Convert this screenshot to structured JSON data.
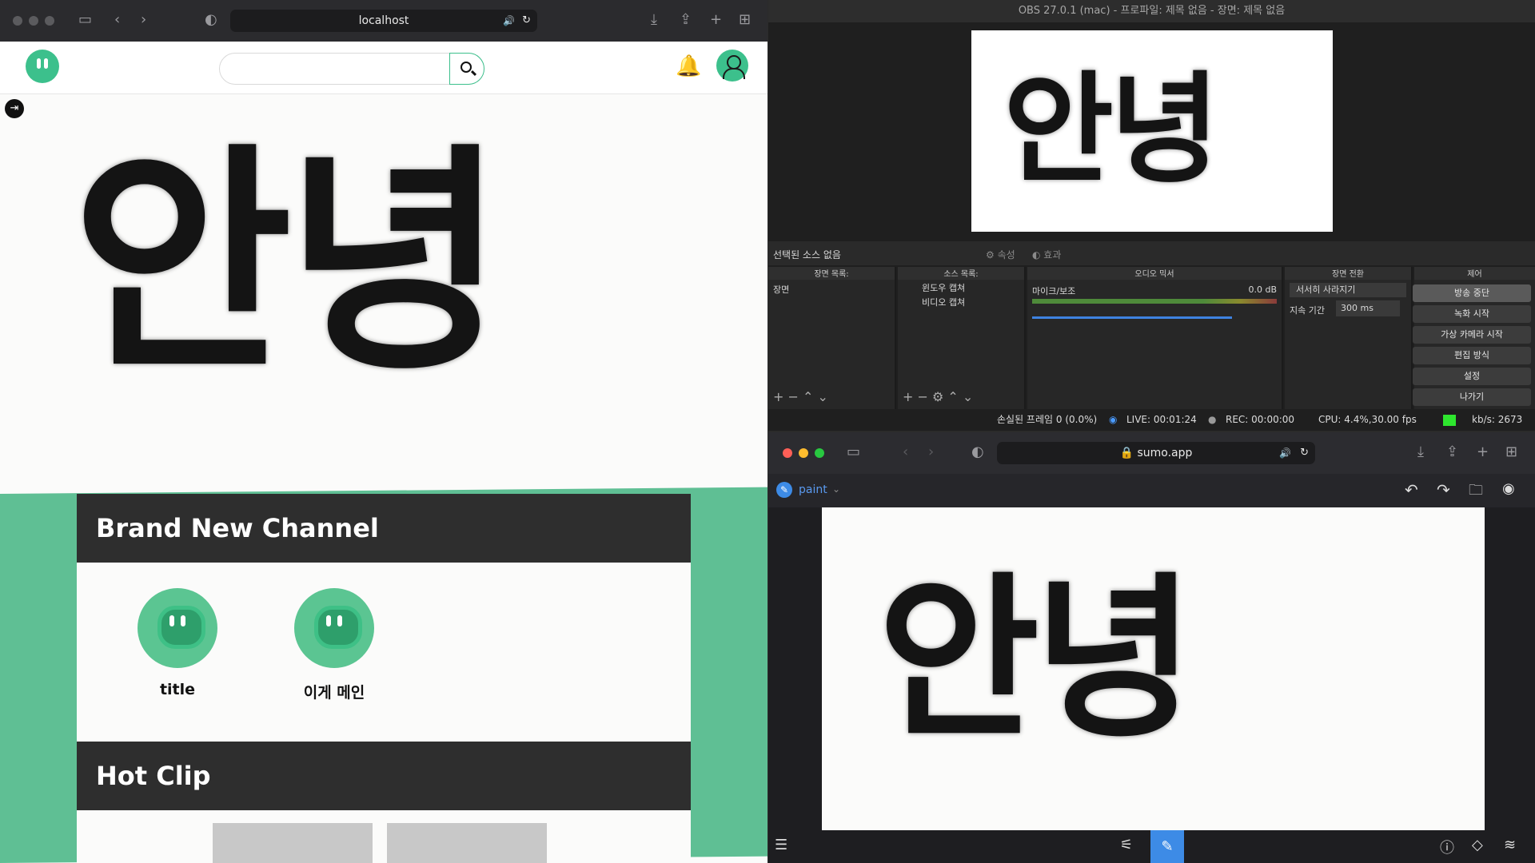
{
  "left_browser": {
    "url": "localhost",
    "drawn_text": "안녕",
    "sections": {
      "brand_new_channel": "Brand New Channel",
      "hot_clip": "Hot Clip"
    },
    "channels": [
      {
        "name": "title"
      },
      {
        "name": "이게 메인"
      }
    ]
  },
  "obs": {
    "title": "OBS 27.0.1 (mac) - 프로파일: 제목 없음 - 장면: 제목 없음",
    "preview_text": "안녕",
    "no_source": "선택된 소스 없음",
    "props": "속성",
    "filters": "효과",
    "docks": {
      "scenes": "장면 목록:",
      "sources": "소스 목록:",
      "mixer": "오디오 믹서",
      "transitions": "장면 전환",
      "controls": "제어"
    },
    "scene_item": "장면",
    "sources": [
      "윈도우 캡쳐",
      "비디오 캡쳐"
    ],
    "mixer": {
      "name": "마이크/보조",
      "db": "0.0 dB"
    },
    "transition": {
      "type": "서서히 사라지기",
      "duration_label": "지속 기간",
      "duration": "300 ms"
    },
    "controls": [
      "방송 중단",
      "녹화 시작",
      "가상 카메라 시작",
      "편집 방식",
      "설정",
      "나가기"
    ],
    "status": {
      "dropped": "손실된 프레임 0 (0.0%)",
      "live": "LIVE: 00:01:24",
      "rec": "REC: 00:00:00",
      "cpu": "CPU: 4.4%,30.00 fps",
      "kbs": "kb/s: 2673"
    }
  },
  "paint_browser": {
    "url": "sumo.app",
    "app_name": "paint",
    "drawn_text": "안녕"
  }
}
